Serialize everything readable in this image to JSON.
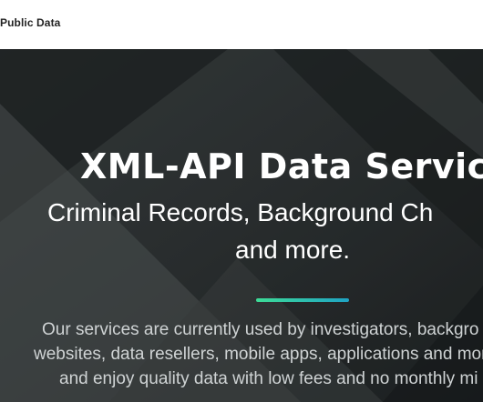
{
  "header": {
    "brand": "Public Data"
  },
  "hero": {
    "title": "XML-API Data Servic",
    "subtitle_line1": "Criminal Records, Background Ch",
    "subtitle_line2": "and more.",
    "description_lines": [
      "Our services are currently used by investigators, backgro",
      "websites, data resellers, mobile apps, applications and mor",
      "and enjoy quality data with low fees and no monthly mi"
    ]
  },
  "colors": {
    "hero_background": "#2b2f30",
    "divider_start": "#3ddc97",
    "divider_end": "#1fa3c4",
    "title_text": "#ffffff",
    "description_text": "#cfd3d4"
  }
}
